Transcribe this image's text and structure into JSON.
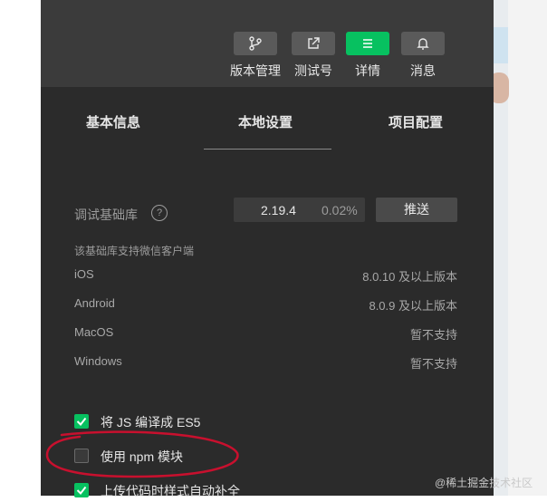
{
  "toolbar": {
    "buttons": [
      {
        "label": "版本管理",
        "icon": "branch-icon",
        "active": false
      },
      {
        "label": "测试号",
        "icon": "external-link-icon",
        "active": false
      },
      {
        "label": "详情",
        "icon": "menu-icon",
        "active": true
      },
      {
        "label": "消息",
        "icon": "bell-icon",
        "active": false
      }
    ]
  },
  "tabs": [
    {
      "label": "基本信息"
    },
    {
      "label": "本地设置"
    },
    {
      "label": "项目配置"
    }
  ],
  "debug_lib": {
    "label": "调试基础库",
    "help_icon": "question-circle-icon",
    "version": "2.19.4",
    "percent": "0.02%",
    "push_label": "推送"
  },
  "support": {
    "title": "该基础库支持微信客户端",
    "clients": [
      {
        "name": "iOS",
        "value": "8.0.10 及以上版本"
      },
      {
        "name": "Android",
        "value": "8.0.9 及以上版本"
      },
      {
        "name": "MacOS",
        "value": "暂不支持"
      },
      {
        "name": "Windows",
        "value": "暂不支持"
      }
    ]
  },
  "options": [
    {
      "label": "将 JS 编译成 ES5",
      "checked": true
    },
    {
      "label": "使用 npm 模块",
      "checked": false
    },
    {
      "label": "上传代码时样式自动补全",
      "checked": true
    }
  ],
  "watermark": "@稀土掘金技术社区",
  "colors": {
    "accent": "#07c160",
    "panel": "#2b2b2b",
    "annotation": "#c8102e"
  }
}
